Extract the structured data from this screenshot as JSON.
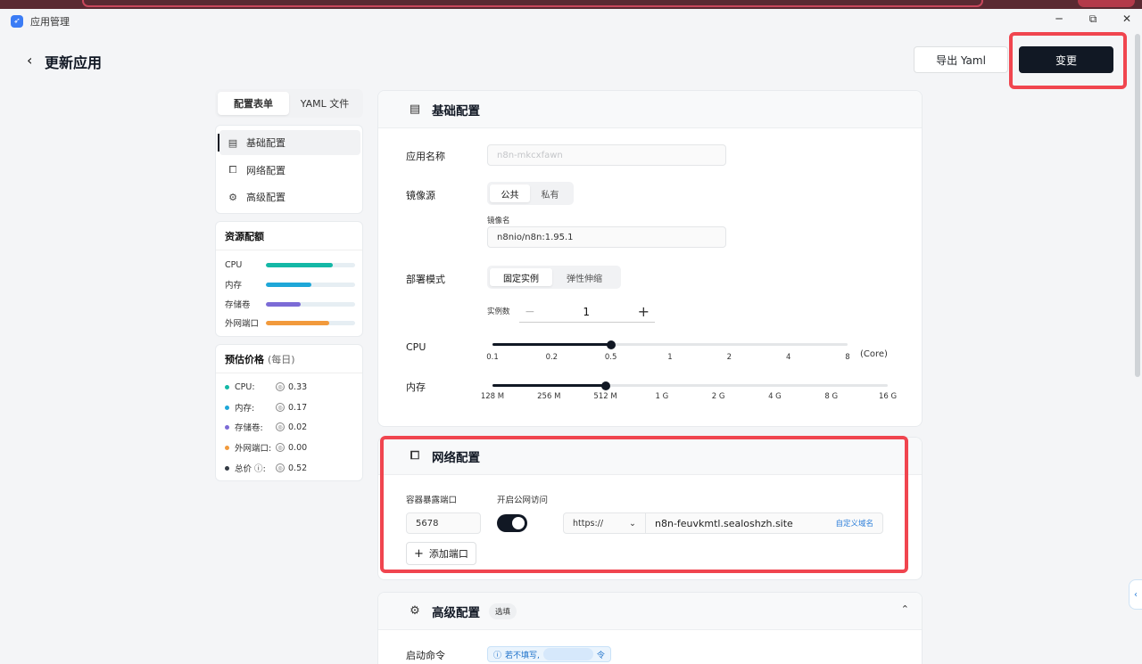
{
  "app": {
    "title": "应用管理"
  },
  "window_controls": {
    "minimize": "─",
    "restore": "⧉",
    "close": "✕"
  },
  "header": {
    "title": "更新应用",
    "export_label": "导出 Yaml",
    "apply_label": "变更"
  },
  "left": {
    "tabs": [
      {
        "label": "配置表单",
        "active": true
      },
      {
        "label": "YAML 文件",
        "active": false
      }
    ],
    "nav": [
      {
        "label": "基础配置",
        "icon": "document-icon",
        "active": true
      },
      {
        "label": "网络配置",
        "icon": "network-icon",
        "active": false
      },
      {
        "label": "高级配置",
        "icon": "gear-icon",
        "active": false
      }
    ],
    "resources": {
      "title": "资源配额",
      "items": [
        {
          "label": "CPU",
          "color": "#14b8a6",
          "fraction": 0.75
        },
        {
          "label": "内存",
          "color": "#1ea7d8",
          "fraction": 0.51
        },
        {
          "label": "存储卷",
          "color": "#7c6bd6",
          "fraction": 0.39
        },
        {
          "label": "外网端口",
          "color": "#f29a3c",
          "fraction": 0.71
        }
      ]
    },
    "price": {
      "title": "预估价格",
      "subtitle": "(每日)",
      "items": [
        {
          "label": "CPU:",
          "value": "0.33",
          "color": "#14b8a6"
        },
        {
          "label": "内存:",
          "value": "0.17",
          "color": "#1ea7d8"
        },
        {
          "label": "存储卷:",
          "value": "0.02",
          "color": "#7c6bd6"
        },
        {
          "label": "外网端口:",
          "value": "0.00",
          "color": "#f29a3c"
        },
        {
          "label": "总价",
          "value": "0.52",
          "color": "#333a44"
        }
      ]
    }
  },
  "basic": {
    "title": "基础配置",
    "app_name_label": "应用名称",
    "app_name_value": "n8n-mkcxfawn",
    "image_source_label": "镜像源",
    "image_source_options": [
      {
        "label": "公共",
        "active": true
      },
      {
        "label": "私有",
        "active": false
      }
    ],
    "image_name_label": "镜像名",
    "image_name_value": "n8nio/n8n:1.95.1",
    "deploy_mode_label": "部署模式",
    "deploy_mode_options": [
      {
        "label": "固定实例",
        "active": true
      },
      {
        "label": "弹性伸缩",
        "active": false
      }
    ],
    "instances_label": "实例数",
    "instances_value": "1",
    "cpu_label": "CPU",
    "cpu_ticks": [
      "0.1",
      "0.2",
      "0.5",
      "1",
      "2",
      "4",
      "8"
    ],
    "cpu_unit": "(Core)",
    "cpu_selected": "0.5",
    "memory_label": "内存",
    "memory_ticks": [
      "128 M",
      "256 M",
      "512 M",
      "1 G",
      "2 G",
      "4 G",
      "8 G",
      "16 G"
    ],
    "memory_selected": "512 M"
  },
  "network": {
    "title": "网络配置",
    "port_label": "容器暴露端口",
    "public_label": "开启公网访问",
    "port_value": "5678",
    "public_enabled": true,
    "protocol": "https://",
    "domain": "n8n-feuvkmtl.sealoshzh.site",
    "custom_domain_label": "自定义域名",
    "add_port_label": "添加端口"
  },
  "advanced": {
    "title": "高级配置",
    "badge": "选填",
    "startup_command_label": "启动命令",
    "tip_prefix": "若不填写,",
    "tip_suffix": "令"
  }
}
